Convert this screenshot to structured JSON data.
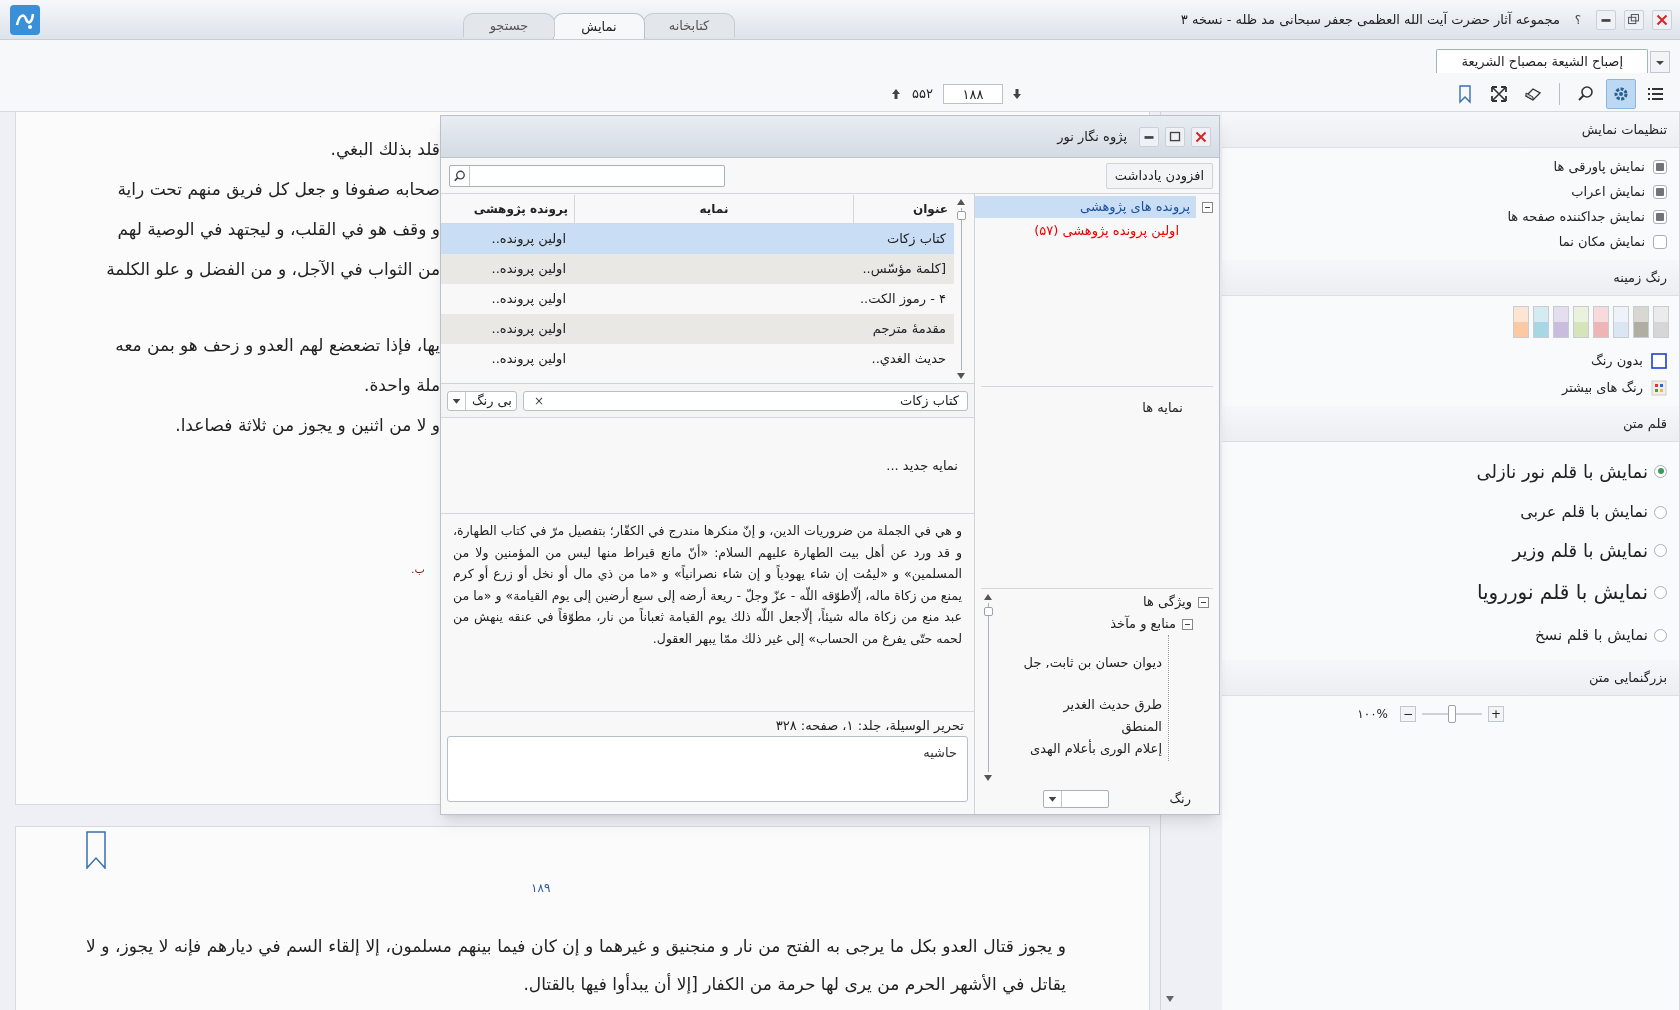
{
  "app": {
    "title": "مجموعه آثار حضرت آیت الله العظمی جعفر سبحانی مد ظله - نسخه ۳",
    "help": "؟"
  },
  "main_tabs": [
    {
      "label": "کتابخانه",
      "selected": false
    },
    {
      "label": "نمایش",
      "selected": true
    },
    {
      "label": "جستجو",
      "selected": false
    }
  ],
  "book_tabs": [
    {
      "label": "إصباح الشيعة بمصباح الشريعة",
      "selected": true
    }
  ],
  "page_nav": {
    "total": "۵۵۲",
    "current": "۱۸۸"
  },
  "toolbar": [
    {
      "kind": "list",
      "selected": false
    },
    {
      "kind": "settings",
      "selected": true
    },
    {
      "kind": "search",
      "selected": false
    },
    {
      "kind": "eraser",
      "selected": false
    },
    {
      "kind": "expand",
      "selected": false
    },
    {
      "kind": "bookmark",
      "selected": false
    }
  ],
  "document": {
    "pages": [
      {
        "lines": [
          "قلد بذلك البغي.",
          "صحابه صفوفا و جعل كل فريق منهم تحت راية",
          "و وقف هو في القلب، و ليجتهد في الوصية لهم",
          "من الثواب في الآجل، و من الفضل و علو الكلمة",
          "يها، فإذا تضعضع لهم العدو و زحف هو بمن معه",
          "ملة واحدة.",
          "و لا من اثنين و يجوز من ثلاثة فصاعدا."
        ],
        "note": "ب."
      },
      {
        "bookmarked": true,
        "page_number": "۱۸۹",
        "paragraph": "و يجوز قتال العدو بكل ما يرجى به الفتح من نار و منجنيق و غيرهما و إن كان فيما بينهم مسلمون، إلا إلقاء السم في ديارهم فإنه لا يجوز، و لا يقاتل في الأشهر الحرم من يرى لها حرمة من الكفار [إلا أن يبدأوا فيها بالقتال."
      }
    ]
  },
  "dialog": {
    "title": "پژوه نگار نور",
    "add_note_button": "افزودن یادداشت",
    "tree": [
      {
        "label": "پرونده های پژوهشی",
        "selected": true,
        "expanded": true,
        "children": [
          {
            "label": "اولین پرونده پژوهشی (۵۷)",
            "selected": false
          }
        ]
      }
    ],
    "table": {
      "columns": [
        "عنوان",
        "نمایه",
        "پرونده پژوهشی"
      ],
      "rows": [
        {
          "title": "کتاب زکات",
          "file": "اولین پرونده..",
          "selected": true
        },
        {
          "title": "[كلمة مؤسّس..",
          "file": "اولین پرونده..",
          "selected": false
        },
        {
          "title": "۴ - رموز الكت..",
          "file": "اولین پرونده..",
          "selected": false
        },
        {
          "title": "مقدمۀ مترجم",
          "file": "اولین پرونده..",
          "selected": false
        },
        {
          "title": "حديث الغدي..",
          "file": "اولین پرونده..",
          "selected": false
        }
      ]
    },
    "tag": {
      "value": "کتاب زکات",
      "remove": "×",
      "color_choice": "بی رنگ"
    },
    "indexes_label": "نمایه ها",
    "new_index": "نمایه جدید ...",
    "excerpt": "و هي في الجملة من ضروريات الدين، و إنّ منكرها مندرج في الكفّار؛ بتفصيل مرّ في كتاب الطهارة، و قد ورد عن أهل بيت الطهارة عليهم السلام: «أنّ مانع قيراط منها ليس من المؤمنين ولا من المسلمين» و «ليمُت إن شاء يهودياً و إن شاء نصرانياً» و «ما من ذي مال أو نخل أو زرع أو كرم يمنع من زكاة ماله، إلّاطوّقه اللّه - عزّ وجلّ - ريعة أرضه إلى سبع أرضين إلى يوم القيامة» و «ما من عبد منع من زكاة ماله شيئاً، إلّاجعل اللّه ذلك يوم القيامة ثعباناً من نار، مطوّقاً في عنقه ينهش من لحمه حتّى يفرغ من الحساب» إلى غير ذلك ممّا يبهر العقول.",
    "source": "تحریر الوسیلة، جلد: ۱، صفحه: ۳۲۸",
    "note": {
      "placeholder": "حاشیه"
    },
    "properties": [
      {
        "label": "ویژگی ها",
        "expanded": true,
        "children": [
          {
            "label": "منابع و مآخذ",
            "expanded": true,
            "children": [
              {
                "label": "ديوان حسان بن ثابت, جل"
              },
              {
                "label": "طرق حديث الغدير"
              },
              {
                "label": "المنطق"
              },
              {
                "label": "إعلام الورى بأعلام الهدى"
              }
            ]
          }
        ]
      }
    ],
    "color_label": "رنگ"
  },
  "settings": {
    "title": "تنظیمات نمایش",
    "options": [
      {
        "label": "نمایش پاورقی ها",
        "checked": true
      },
      {
        "label": "نمایش اعراب",
        "checked": true
      },
      {
        "label": "نمایش جداکننده صفحه ها",
        "checked": true
      },
      {
        "label": "نمایش مکان نما",
        "checked": false
      }
    ],
    "background": {
      "title": "رنگ زمینه",
      "swatches": [
        {
          "color": "#d6d6d6"
        },
        {
          "color": "#b0aea3"
        },
        {
          "color": "#dbe6f2"
        },
        {
          "color": "#eeb5b7"
        },
        {
          "color": "#d5e4bb"
        },
        {
          "color": "#c9bcdc"
        },
        {
          "color": "#a8d7e3"
        },
        {
          "color": "#fcc9a5"
        }
      ],
      "no_color": "بدون رنگ",
      "more_colors": "رنگ های بیشتر"
    },
    "font": {
      "title": "قلم متن",
      "choices": [
        {
          "label": "نمایش با قلم نور نازلی",
          "selected": true
        },
        {
          "label": "نمایش با قلم عربی",
          "selected": false
        },
        {
          "label": "نمایش با قلم وزیر",
          "selected": false
        },
        {
          "label": "نمایش با قلم نوررویا",
          "selected": false
        },
        {
          "label": "نمایش با قلم نسخ",
          "selected": false
        }
      ]
    },
    "zoom": {
      "title": "بزرگنمایی متن",
      "reading": "۱۰۰%",
      "minus": "−",
      "plus": "+",
      "level": 0.5
    }
  }
}
